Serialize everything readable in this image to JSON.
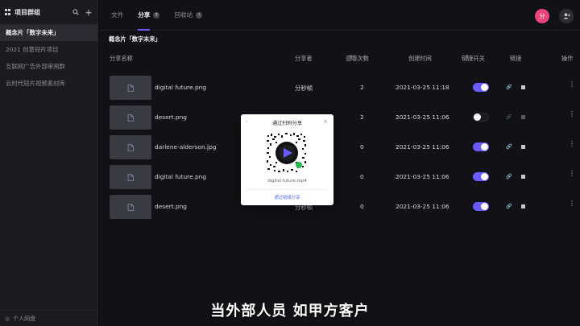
{
  "sidebar": {
    "title": "项目群组",
    "items": [
      {
        "label": "概念片「数字未来」",
        "active": true
      },
      {
        "label": "2021 创意短片项目",
        "active": false
      },
      {
        "label": "互联网广告外部审阅群",
        "active": false
      },
      {
        "label": "云时代短片视频素材库",
        "active": false
      }
    ],
    "footer": "个人网盘"
  },
  "tabs": [
    {
      "label": "文件"
    },
    {
      "label": "分享"
    },
    {
      "label": "回收站"
    }
  ],
  "header": {
    "avatar_text": "分"
  },
  "breadcrumb": "概念片「数字未来」",
  "table": {
    "columns": {
      "name": "分享名称",
      "sharer": "分享者",
      "views": "查看次数",
      "created": "创建时间",
      "link_switch": "链接开关",
      "link": "链接",
      "actions": "操作"
    },
    "rows": [
      {
        "name": "digital future.png",
        "sharer": "分秒帧",
        "views": "2",
        "created": "2021-03-25 11:18",
        "link_on": true
      },
      {
        "name": "desert.png",
        "sharer": "",
        "views": "2",
        "created": "2021-03-25 11:06",
        "link_on": false
      },
      {
        "name": "darlene-alderson.jpg",
        "sharer": "",
        "views": "0",
        "created": "2021-03-25 11:06",
        "link_on": true
      },
      {
        "name": "digital future.png",
        "sharer": "",
        "views": "0",
        "created": "2021-03-25 11:06",
        "link_on": true
      },
      {
        "name": "desert.png",
        "sharer": "分秒帧",
        "views": "0",
        "created": "2021-03-25 11:06",
        "link_on": true
      }
    ]
  },
  "dialog": {
    "title": "通过扫码分享",
    "file_name": "digital future.mp4",
    "link_text": "通过链接分享"
  },
  "caption": "当外部人员  如甲方客户",
  "colors": {
    "accent": "#6b5cff",
    "avatar": "#e8457a"
  }
}
